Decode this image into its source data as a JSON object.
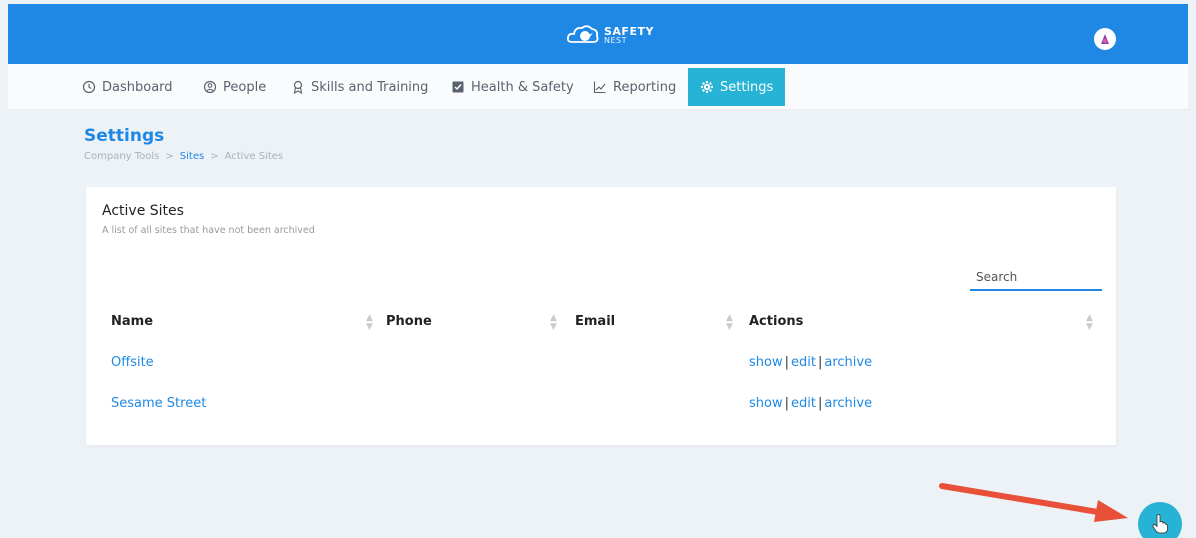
{
  "header": {
    "logo_line1": "SAFETY",
    "logo_line2": "NEST"
  },
  "nav": {
    "items": [
      {
        "label": "Dashboard",
        "icon": "clock-icon"
      },
      {
        "label": "People",
        "icon": "person-icon"
      },
      {
        "label": "Skills and Training",
        "icon": "award-icon"
      },
      {
        "label": "Health & Safety",
        "icon": "checklist-icon"
      },
      {
        "label": "Reporting",
        "icon": "chart-line-icon"
      },
      {
        "label": "Settings",
        "icon": "gear-icon",
        "active": true
      }
    ]
  },
  "page": {
    "title": "Settings",
    "breadcrumb": [
      "Company Tools",
      ">",
      "Sites",
      ">",
      "Active Sites"
    ]
  },
  "card": {
    "title": "Active Sites",
    "subtitle": "A list of all sites that have not been archived",
    "search_placeholder": "Search",
    "columns": [
      "Name",
      "Phone",
      "Email",
      "Actions"
    ],
    "rows": [
      {
        "name": "Offsite",
        "phone": "",
        "email": "",
        "actions": [
          "show",
          "edit",
          "archive"
        ]
      },
      {
        "name": "Sesame Street",
        "phone": "",
        "email": "",
        "actions": [
          "show",
          "edit",
          "archive"
        ]
      }
    ]
  },
  "colors": {
    "primary": "#1f88e5",
    "accent": "#26b3d6",
    "arrow": "#e8503a"
  }
}
